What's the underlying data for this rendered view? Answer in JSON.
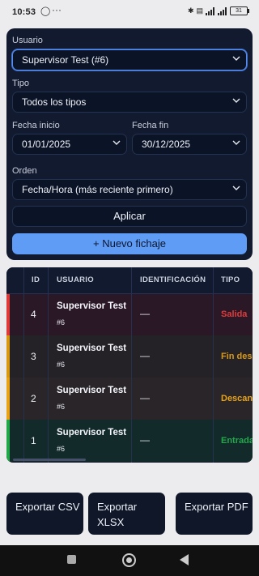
{
  "status": {
    "time": "10:53",
    "battery": "31"
  },
  "filters": {
    "usuario_label": "Usuario",
    "usuario_value": "Supervisor Test (#6)",
    "tipo_label": "Tipo",
    "tipo_value": "Todos los tipos",
    "fecha_inicio_label": "Fecha inicio",
    "fecha_inicio_value": "01/01/2025",
    "fecha_fin_label": "Fecha fin",
    "fecha_fin_value": "30/12/2025",
    "orden_label": "Orden",
    "orden_value": "Fecha/Hora (más reciente primero)",
    "apply_label": "Aplicar",
    "new_label": "+ Nuevo fichaje"
  },
  "table": {
    "headers": [
      "ID",
      "USUARIO",
      "IDENTIFICACIÓN",
      "TIPO"
    ],
    "rows": [
      {
        "id": "4",
        "user": "Supervisor Test",
        "tag": "#6",
        "ident": "—",
        "tipo": "Salida",
        "color": "#e03b3b",
        "bg": "#2a1826"
      },
      {
        "id": "3",
        "user": "Supervisor Test",
        "tag": "#6",
        "ident": "—",
        "tipo": "Fin des",
        "color": "#d99a12",
        "bg": "#242127"
      },
      {
        "id": "2",
        "user": "Supervisor Test",
        "tag": "#6",
        "ident": "—",
        "tipo": "Descan",
        "color": "#e8a317",
        "bg": "#2a2528"
      },
      {
        "id": "1",
        "user": "Supervisor Test",
        "tag": "#6",
        "ident": "—",
        "tipo": "Entrada",
        "color": "#22a84a",
        "bg": "#122a2a"
      }
    ]
  },
  "exports": {
    "csv": "Exportar CSV",
    "xlsx": "Exportar XLSX",
    "pdf": "Exportar PDF"
  }
}
